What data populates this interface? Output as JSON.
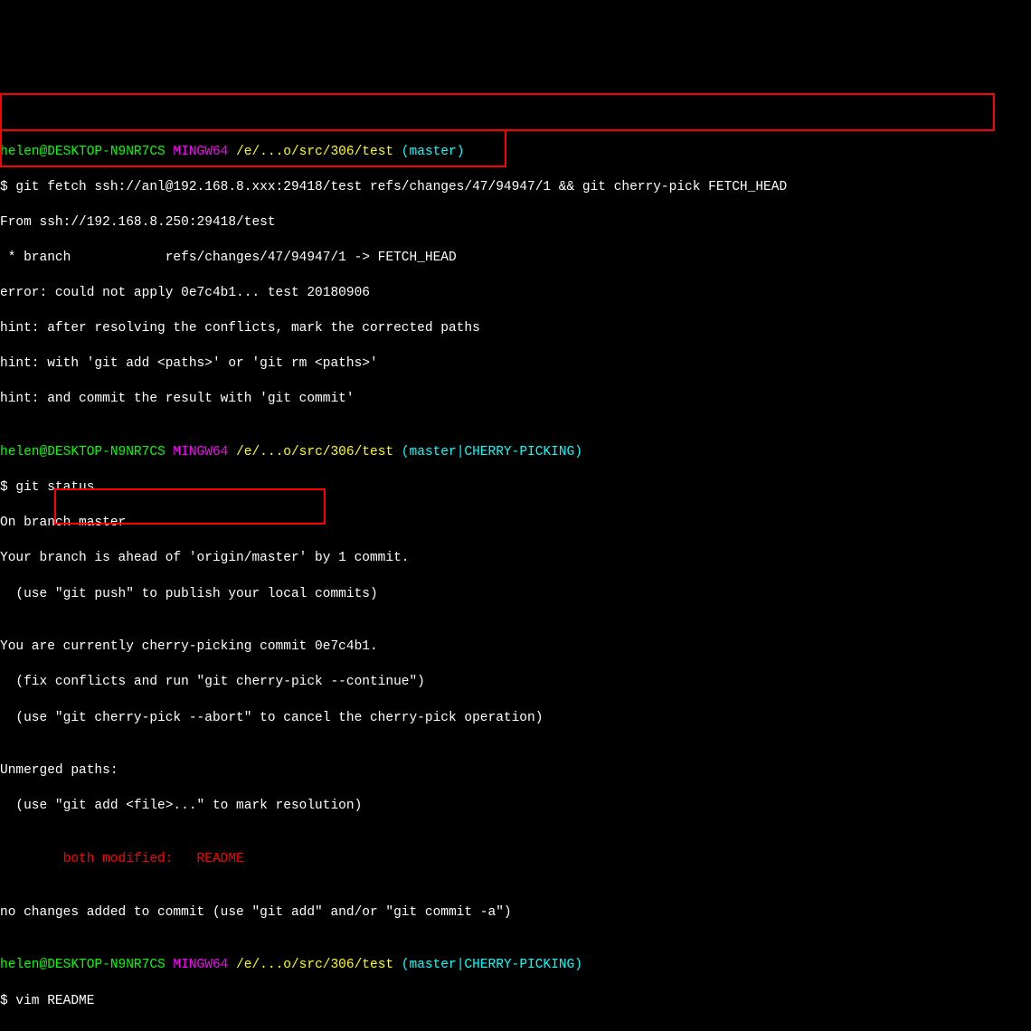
{
  "prompt1": {
    "user_host": "helen@DESKTOP-N9NR7CS",
    "shell": " MINGW64 ",
    "path": "/e/...o/src/306/test",
    "branch": " (master)"
  },
  "cmd1": "$ git fetch ssh://anl@192.168.8.xxx:29418/test refs/changes/47/94947/1 && git cherry-pick FETCH_HEAD",
  "fetch_from": "From ssh://192.168.8.250:29418/test",
  "fetch_branch": " * branch            refs/changes/47/94947/1 -> FETCH_HEAD",
  "error_line": "error: could not apply 0e7c4b1... test 20180906",
  "hint1": "hint: after resolving the conflicts, mark the corrected paths",
  "hint2": "hint: with 'git add <paths>' or 'git rm <paths>'",
  "hint3": "hint: and commit the result with 'git commit'",
  "blank": "",
  "prompt2": {
    "user_host": "helen@DESKTOP-N9NR7CS",
    "shell": " MINGW64 ",
    "path": "/e/...o/src/306/test",
    "branch": " (master|CHERRY-PICKING)"
  },
  "cmd2": "$ git status",
  "status1": "On branch master",
  "status2": "Your branch is ahead of 'origin/master' by 1 commit.",
  "status3": "  (use \"git push\" to publish your local commits)",
  "status4": "You are currently cherry-picking commit 0e7c4b1.",
  "status5": "  (fix conflicts and run \"git cherry-pick --continue\")",
  "status6": "  (use \"git cherry-pick --abort\" to cancel the cherry-pick operation)",
  "status7": "Unmerged paths:",
  "status8": "  (use \"git add <file>...\" to mark resolution)",
  "unmerged": "        both modified:   README",
  "status9": "no changes added to commit (use \"git add\" and/or \"git commit -a\")",
  "prompt3": {
    "user_host": "helen@DESKTOP-N9NR7CS",
    "shell": " MINGW64 ",
    "path": "/e/...o/src/306/test",
    "branch": " (master|CHERRY-PICKING)"
  },
  "cmd3": "$ vim README"
}
